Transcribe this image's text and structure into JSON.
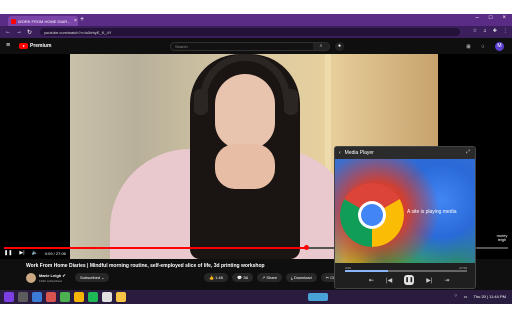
{
  "browser": {
    "tab_title": "WORK FROM HOME DIAR...",
    "new_tab_symbol": "+",
    "url": "youtube.com/watch?v=lu5ehyE_K_4Y"
  },
  "youtube": {
    "logo_text": "Premium",
    "search_placeholder": "Search",
    "avatar_letter": "M"
  },
  "player": {
    "progress_fraction": 0.6,
    "time": "0:09 / 27:06",
    "watermark": "moley leigh"
  },
  "video": {
    "title": "Work From Home Diaries | Mindful morning routine, self-employed slice of life, 3d printing workshop",
    "channel_name": "Marie Leigh ✔",
    "subscribers": "149K subscribers",
    "subscribe_label": "Subscribed ⌄",
    "likes": "1.4K",
    "comments": "38",
    "share_label": "Share",
    "download_label": "Download",
    "clip_label": "Clip"
  },
  "media_player": {
    "title": "Media Player",
    "message": "A site is playing media",
    "current_time": "0:09",
    "total_time": "-27:00",
    "progress_fraction": 0.35
  },
  "taskbar": {
    "datetime": "Thu 20 | 11:44 PM"
  },
  "colors": {
    "accent": "#ff0000",
    "browser_purple": "#5b2c86",
    "mp_progress": "#8ab4f8"
  }
}
